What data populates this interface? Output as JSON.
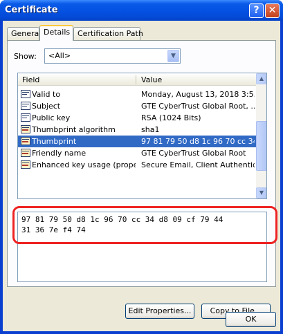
{
  "window": {
    "title": "Certificate",
    "help_glyph": "?",
    "close_glyph": "✕"
  },
  "tabs": [
    {
      "label": "General"
    },
    {
      "label": "Details"
    },
    {
      "label": "Certification Path"
    }
  ],
  "show": {
    "label": "Show:",
    "value": "<All>"
  },
  "list": {
    "columns": {
      "field": "Field",
      "value": "Value"
    },
    "rows": [
      {
        "field": "Valid to",
        "value": "Monday, August 13, 2018 3:5...",
        "icon": "cert-field-icon"
      },
      {
        "field": "Subject",
        "value": "GTE CyberTrust Global Root, ...",
        "icon": "cert-field-icon"
      },
      {
        "field": "Public key",
        "value": "RSA (1024 Bits)",
        "icon": "cert-field-icon"
      },
      {
        "field": "Thumbprint algorithm",
        "value": "sha1",
        "icon": "cert-extension-icon"
      },
      {
        "field": "Thumbprint",
        "value": "97 81 79 50 d8 1c 96 70 cc 34 ...",
        "icon": "cert-extension-icon",
        "selected": true
      },
      {
        "field": "Friendly name",
        "value": "GTE CyberTrust Global Root",
        "icon": "cert-extension-icon"
      },
      {
        "field": "Enhanced key usage (prope...",
        "value": "Secure Email, Client Authentic...",
        "icon": "cert-extension-icon"
      }
    ]
  },
  "detail": {
    "text": "97 81 79 50 d8 1c 96 70 cc 34 d8 09 cf 79 44\n31 36 7e f4 74"
  },
  "buttons": {
    "edit_properties": "Edit Properties...",
    "copy_to_file": "Copy to File...",
    "ok": "OK"
  },
  "colors": {
    "selection": "#316ac5",
    "highlight_border": "#ee2222",
    "titlebar": "#0552e3"
  }
}
